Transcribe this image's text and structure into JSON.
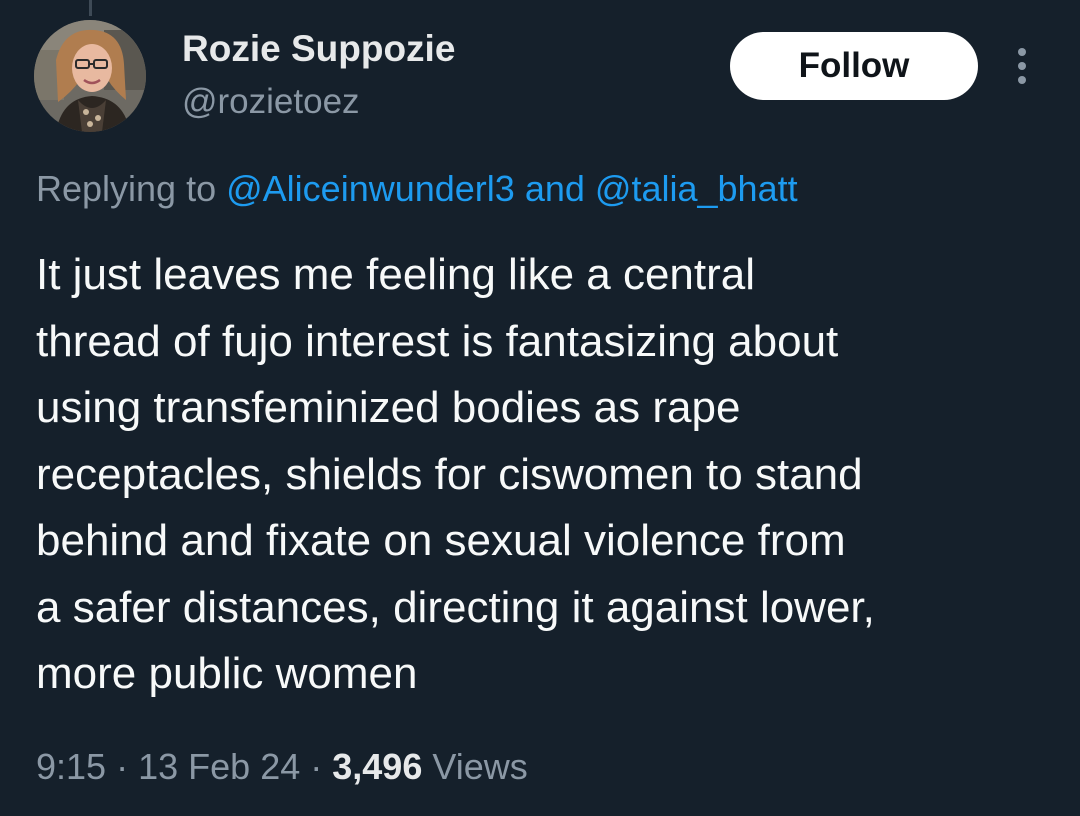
{
  "author": {
    "display_name": "Rozie Suppozie",
    "handle": "@rozietoez"
  },
  "actions": {
    "follow_label": "Follow",
    "more_icon": "more-vertical-icon"
  },
  "reply": {
    "prefix": "Replying to",
    "mention_1": "@Aliceinwunderl3",
    "joiner": "and",
    "mention_2": "@talia_bhatt"
  },
  "tweet": {
    "lines": [
      "It just leaves me feeling like a central",
      "thread of fujo interest is fantasizing about",
      "using transfeminized bodies as rape",
      "receptacles,  shields for ciswomen to stand",
      "behind and fixate on sexual violence from",
      "a safer distances, directing it against lower,",
      "more public women"
    ]
  },
  "meta": {
    "time": "9:15",
    "date": "13 Feb 24",
    "separator": "·",
    "views_count": "3,496",
    "views_label": "Views"
  },
  "colors": {
    "background": "#15202b",
    "primary_text": "#e7e9ea",
    "secondary_text": "#8b98a5",
    "link": "#1d9bf0",
    "follow_bg": "#ffffff"
  }
}
